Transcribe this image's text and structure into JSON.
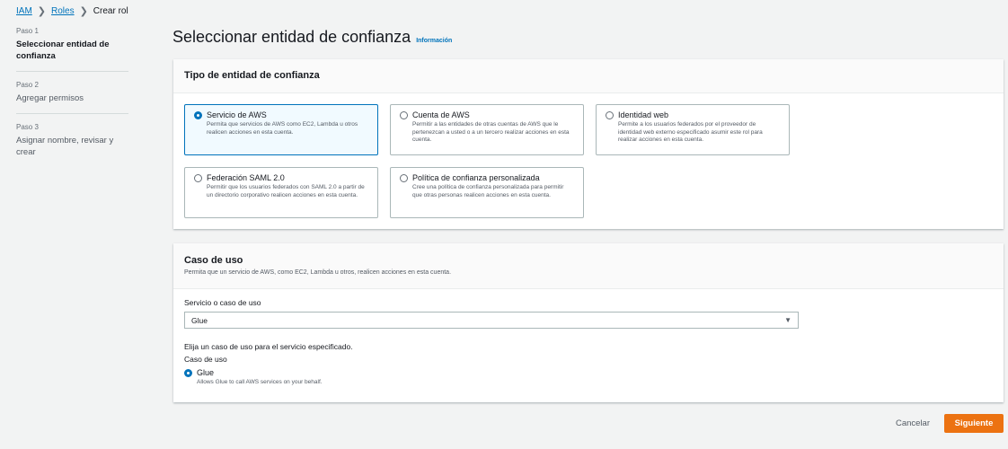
{
  "breadcrumb": {
    "iam": "IAM",
    "roles": "Roles",
    "current": "Crear rol"
  },
  "steps": [
    {
      "num": "Paso 1",
      "title": "Seleccionar entidad de confianza"
    },
    {
      "num": "Paso 2",
      "title": "Agregar permisos"
    },
    {
      "num": "Paso 3",
      "title": "Asignar nombre, revisar y crear"
    }
  ],
  "page": {
    "title": "Seleccionar entidad de confianza",
    "info": "Información"
  },
  "trust": {
    "heading": "Tipo de entidad de confianza",
    "options": [
      {
        "title": "Servicio de AWS",
        "desc": "Permita que servicios de AWS como EC2, Lambda u otros realicen acciones en esta cuenta."
      },
      {
        "title": "Cuenta de AWS",
        "desc": "Permitir a las entidades de otras cuentas de AWS que le pertenezcan a usted o a un tercero realizar acciones en esta cuenta."
      },
      {
        "title": "Identidad web",
        "desc": "Permite a los usuarios federados por el proveedor de identidad web externo especificado asumir este rol para realizar acciones en esta cuenta."
      },
      {
        "title": "Federación SAML 2.0",
        "desc": "Permitir que los usuarios federados con SAML 2.0 a partir de un directorio corporativo realicen acciones en esta cuenta."
      },
      {
        "title": "Política de confianza personalizada",
        "desc": "Cree una política de confianza personalizada para permitir que otras personas realicen acciones en esta cuenta."
      }
    ]
  },
  "usecase": {
    "heading": "Caso de uso",
    "desc": "Permita que un servicio de AWS, como EC2, Lambda u otros, realicen acciones en esta cuenta.",
    "service_label": "Servicio o caso de uso",
    "service_value": "Glue",
    "choose_label": "Elija un caso de uso para el servicio especificado.",
    "usecase_label": "Caso de uso",
    "option_title": "Glue",
    "option_desc": "Allows Glue to call AWS services on your behalf."
  },
  "footer": {
    "cancel": "Cancelar",
    "next": "Siguiente"
  },
  "colors": {
    "accent": "#0073bb",
    "primary_button": "#ec7211"
  }
}
